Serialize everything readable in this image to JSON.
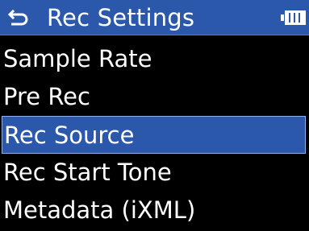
{
  "header": {
    "title": "Rec Settings",
    "back_icon": "back-arrow-icon",
    "battery_icon": "battery-full-icon"
  },
  "menu": {
    "items": [
      {
        "label": "Sample Rate",
        "selected": false
      },
      {
        "label": "Pre Rec",
        "selected": false
      },
      {
        "label": "Rec Source",
        "selected": true
      },
      {
        "label": "Rec Start Tone",
        "selected": false
      },
      {
        "label": "Metadata (iXML)",
        "selected": false
      }
    ]
  },
  "colors": {
    "background": "#000000",
    "highlight": "#2b58aa",
    "text": "#ffffff"
  }
}
